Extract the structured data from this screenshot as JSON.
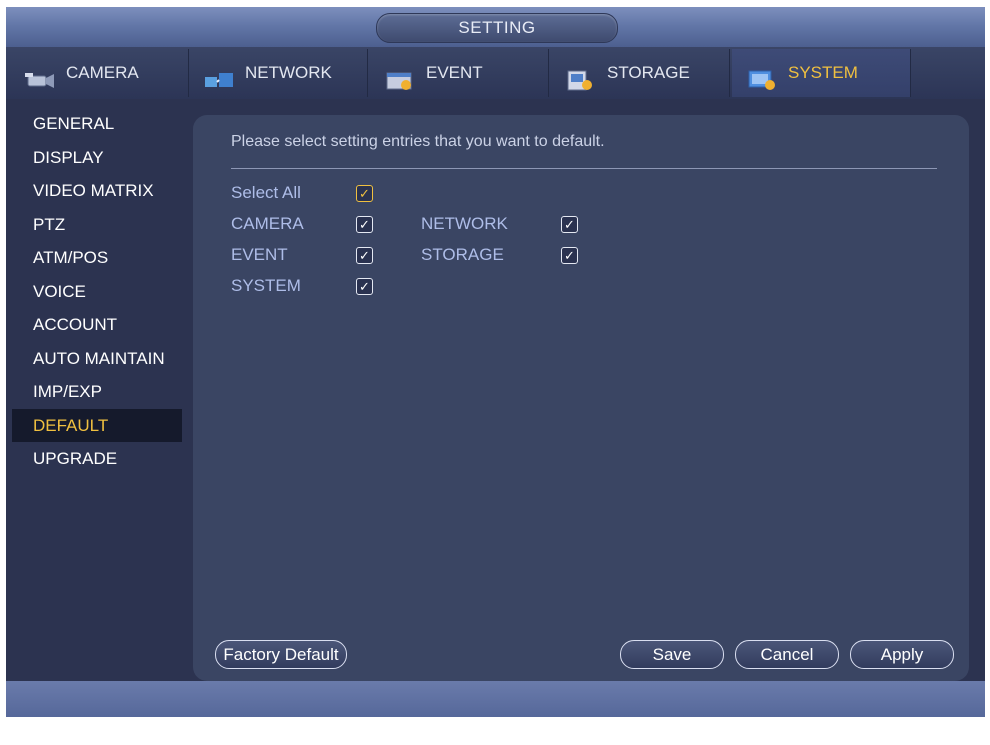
{
  "window": {
    "title": "SETTING"
  },
  "tabs": [
    {
      "label": "CAMERA",
      "icon": "camera-icon"
    },
    {
      "label": "NETWORK",
      "icon": "network-icon"
    },
    {
      "label": "EVENT",
      "icon": "event-icon"
    },
    {
      "label": "STORAGE",
      "icon": "storage-icon"
    },
    {
      "label": "SYSTEM",
      "icon": "system-icon",
      "active": true
    }
  ],
  "sidebar": {
    "items": [
      {
        "label": "GENERAL"
      },
      {
        "label": "DISPLAY"
      },
      {
        "label": "VIDEO MATRIX"
      },
      {
        "label": "PTZ"
      },
      {
        "label": "ATM/POS"
      },
      {
        "label": "VOICE"
      },
      {
        "label": "ACCOUNT"
      },
      {
        "label": "AUTO MAINTAIN"
      },
      {
        "label": "IMP/EXP"
      },
      {
        "label": "DEFAULT",
        "active": true
      },
      {
        "label": "UPGRADE"
      }
    ]
  },
  "panel": {
    "prompt": "Please select setting entries that you want to default.",
    "select_all": {
      "label": "Select All",
      "checked": true
    },
    "options": [
      {
        "label": "CAMERA",
        "checked": true
      },
      {
        "label": "NETWORK",
        "checked": true
      },
      {
        "label": "EVENT",
        "checked": true
      },
      {
        "label": "STORAGE",
        "checked": true
      },
      {
        "label": "SYSTEM",
        "checked": true
      }
    ]
  },
  "buttons": {
    "factory_default": "Factory Default",
    "save": "Save",
    "cancel": "Cancel",
    "apply": "Apply"
  },
  "colors": {
    "accent": "#f0c040",
    "background": "#2c3350",
    "panel": "#3a4563"
  }
}
